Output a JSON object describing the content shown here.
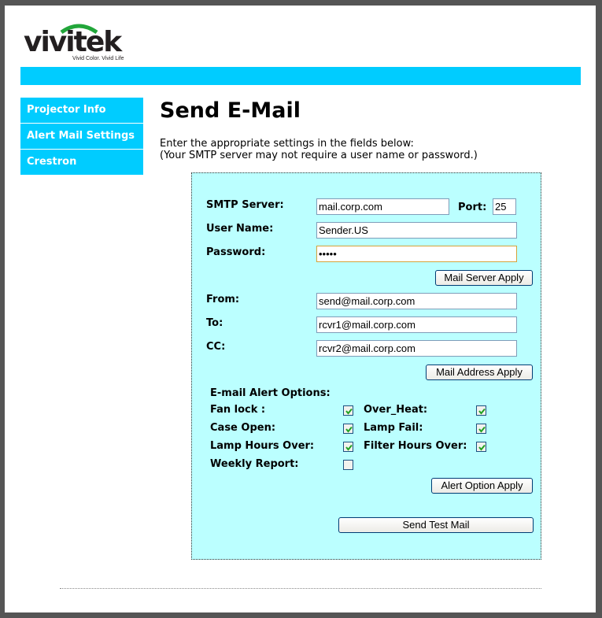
{
  "logo": {
    "brand": "vivitek",
    "tagline": "Vivid Color. Vivid Life",
    "arc_color": "#22a63a"
  },
  "colors": {
    "accent": "#00ccff",
    "panel": "#bbffff"
  },
  "sidebar": {
    "items": [
      {
        "label": "Projector Info"
      },
      {
        "label": "Alert Mail Settings"
      },
      {
        "label": "Crestron"
      }
    ]
  },
  "main": {
    "title": "Send E-Mail",
    "intro_line1": "Enter the appropriate settings in the fields below:",
    "intro_line2": "(Your SMTP server may not require a user name or password.)"
  },
  "form": {
    "smtp_label": "SMTP Server:",
    "smtp_value": "mail.corp.com",
    "port_label": "Port:",
    "port_value": "25",
    "user_label": "User Name:",
    "user_value": "Sender.US",
    "password_label": "Password:",
    "password_value": "•••••",
    "mail_server_apply": "Mail Server Apply",
    "from_label": "From:",
    "from_value": "send@mail.corp.com",
    "to_label": "To:",
    "to_value": "rcvr1@mail.corp.com",
    "cc_label": "CC:",
    "cc_value": "rcvr2@mail.corp.com",
    "mail_address_apply": "Mail Address Apply",
    "alert_options_label": "E-mail Alert Options:",
    "options": [
      {
        "label": "Fan lock :",
        "checked": true
      },
      {
        "label": "Over_Heat:",
        "checked": true
      },
      {
        "label": "Case Open:",
        "checked": true
      },
      {
        "label": "Lamp Fail:",
        "checked": true
      },
      {
        "label": "Lamp Hours Over:",
        "checked": true
      },
      {
        "label": "Filter Hours Over:",
        "checked": true
      },
      {
        "label": "Weekly Report:",
        "checked": false
      }
    ],
    "alert_option_apply": "Alert Option Apply",
    "send_test_mail": "Send Test Mail"
  }
}
